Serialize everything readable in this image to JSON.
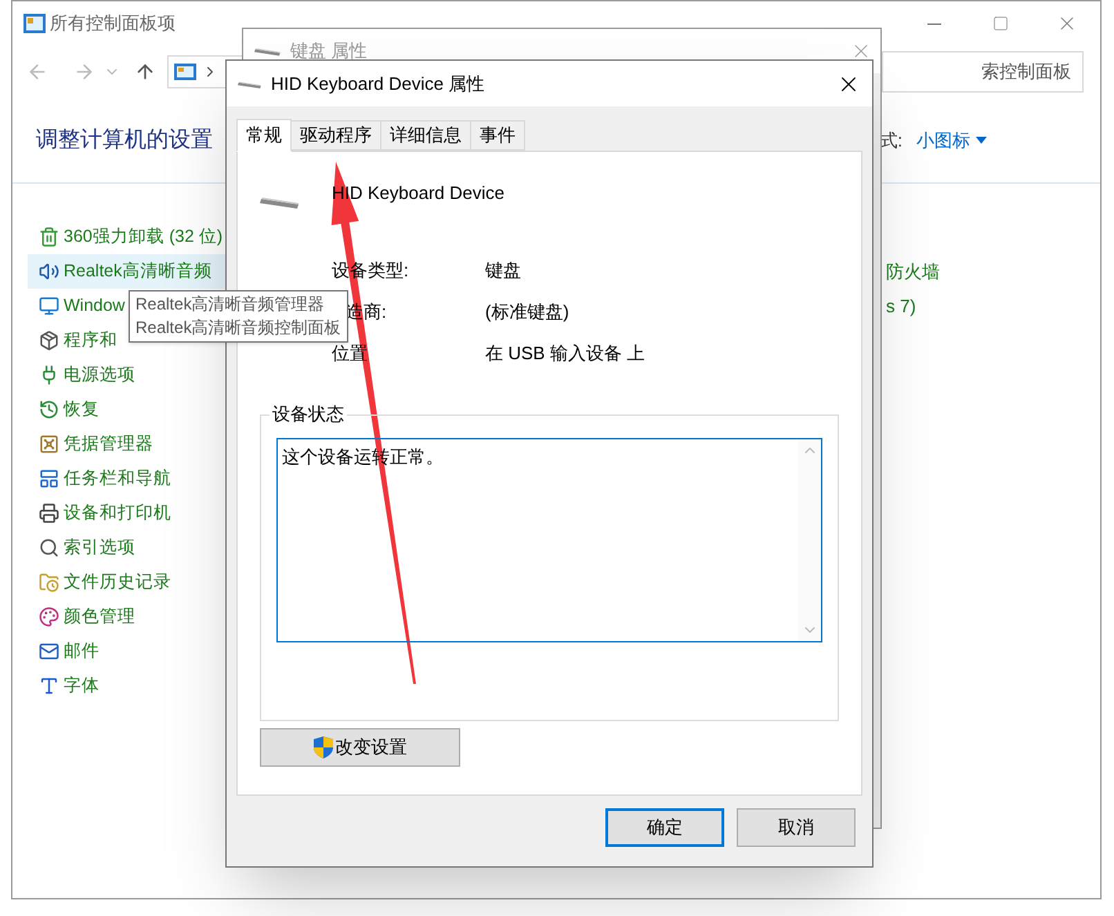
{
  "control_panel": {
    "title": "所有控制面板项",
    "search_placeholder": "索控制面板",
    "heading": "调整计算机的设置",
    "view_label": "式:",
    "view_value": "小图标",
    "items": [
      {
        "label": "360强力卸载 (32 位)",
        "hovered": false
      },
      {
        "label": "Realtek高清晰音频",
        "hovered": true
      },
      {
        "label": "Window",
        "hovered": false
      },
      {
        "label": "程序和",
        "hovered": false
      },
      {
        "label": "电源选项",
        "hovered": false
      },
      {
        "label": "恢复",
        "hovered": false
      },
      {
        "label": "凭据管理器",
        "hovered": false
      },
      {
        "label": "任务栏和导航",
        "hovered": false
      },
      {
        "label": "设备和打印机",
        "hovered": false
      },
      {
        "label": "索引选项",
        "hovered": false
      },
      {
        "label": "文件历史记录",
        "hovered": false
      },
      {
        "label": "颜色管理",
        "hovered": false
      },
      {
        "label": "邮件",
        "hovered": false
      },
      {
        "label": "字体",
        "hovered": false
      }
    ],
    "right_items": [
      "防火墙",
      "s 7)"
    ]
  },
  "tooltip": {
    "lines": [
      "Realtek高清晰音频管理器",
      "Realtek高清晰音频控制面板"
    ]
  },
  "back_window": {
    "title": "键盘 属性"
  },
  "dialog": {
    "title": "HID Keyboard Device 属性",
    "tabs": [
      {
        "label": "常规",
        "selected": true
      },
      {
        "label": "驱动程序",
        "selected": false
      },
      {
        "label": "详细信息",
        "selected": false
      },
      {
        "label": "事件",
        "selected": false
      }
    ],
    "device_name": "HID Keyboard Device",
    "properties": [
      {
        "label": "设备类型:",
        "value": "键盘"
      },
      {
        "label": "造商:",
        "value": "(标准键盘)"
      },
      {
        "label": "位置",
        "value": "在 USB 输入设备 上"
      }
    ],
    "status_group": "设备状态",
    "status_text": "这个设备运转正常。",
    "change_button": "改变设置",
    "buttons": [
      {
        "label": "确定",
        "default": true
      },
      {
        "label": "取消",
        "default": false
      }
    ]
  }
}
